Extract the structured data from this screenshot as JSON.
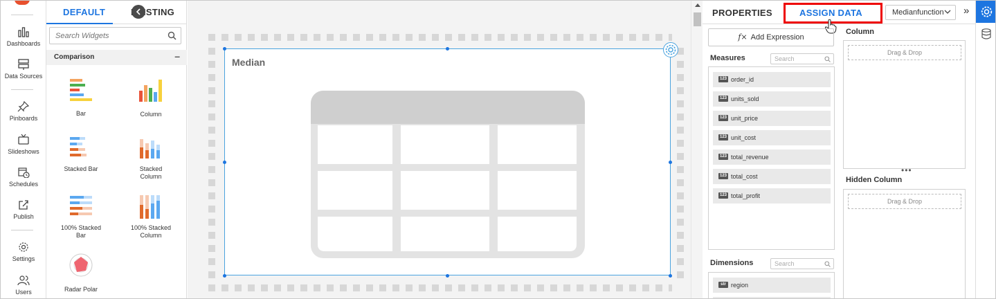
{
  "nav": {
    "items": [
      {
        "label": "Dashboards",
        "icon": "bar-chart-icon"
      },
      {
        "label": "Data Sources",
        "icon": "data-sources-icon"
      },
      {
        "label": "Pinboards",
        "icon": "pin-icon"
      },
      {
        "label": "Slideshows",
        "icon": "tv-icon"
      },
      {
        "label": "Schedules",
        "icon": "calendar-clock-icon"
      },
      {
        "label": "Publish",
        "icon": "share-icon"
      },
      {
        "label": "Settings",
        "icon": "gear-icon"
      },
      {
        "label": "Users",
        "icon": "users-icon"
      }
    ]
  },
  "widget_panel": {
    "tabs": [
      "DEFAULT",
      "EXISTING"
    ],
    "active_tab": "DEFAULT",
    "search_placeholder": "Search Widgets",
    "category": "Comparison",
    "category_toggle": "–",
    "widgets": [
      {
        "label": "Bar"
      },
      {
        "label": "Column"
      },
      {
        "label": "Stacked Bar"
      },
      {
        "label": "Stacked Column"
      },
      {
        "label": "100% Stacked Bar"
      },
      {
        "label": "100% Stacked Column"
      },
      {
        "label": "Radar Polar"
      }
    ]
  },
  "canvas": {
    "widget_title": "Median"
  },
  "properties_panel": {
    "tabs": [
      "PROPERTIES",
      "ASSIGN DATA"
    ],
    "active_tab": "ASSIGN DATA",
    "widget_selector": "Medianfunction",
    "expand_glyph": "»",
    "add_expression": "Add Expression",
    "fx_glyph": "f×",
    "measures_label": "Measures",
    "measures_search": "Search",
    "measures": [
      {
        "type": "123",
        "name": "order_id"
      },
      {
        "type": "123",
        "name": "units_sold"
      },
      {
        "type": "123",
        "name": "unit_price"
      },
      {
        "type": "123",
        "name": "unit_cost"
      },
      {
        "type": "123",
        "name": "total_revenue"
      },
      {
        "type": "123",
        "name": "total_cost"
      },
      {
        "type": "123",
        "name": "total_profit"
      }
    ],
    "dimensions_label": "Dimensions",
    "dimensions_search": "Search",
    "dimensions": [
      {
        "type": "str",
        "name": "region"
      }
    ],
    "column_label": "Column",
    "hidden_column_label": "Hidden Column",
    "drag_drop": "Drag & Drop",
    "more_dots": "•••"
  },
  "colors": {
    "accent": "#1d75e0",
    "highlight": "#ee0000",
    "card_border": "#4aa3df"
  }
}
